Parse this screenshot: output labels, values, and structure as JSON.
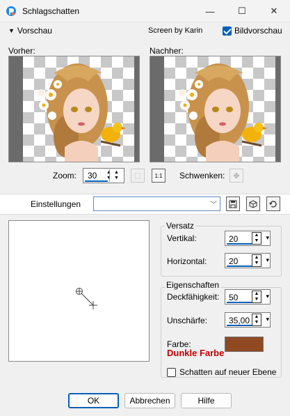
{
  "window": {
    "title": "Schlagschatten",
    "minimize_glyph": "—",
    "maximize_glyph": "☐",
    "close_glyph": "✕"
  },
  "preview": {
    "toggle_label": "Vorschau",
    "credit": "Screen by Karin",
    "live_preview_label": "Bildvorschau",
    "live_preview_checked": true,
    "before_label": "Vorher:",
    "after_label": "Nachher:"
  },
  "zoom": {
    "label": "Zoom:",
    "value": "30",
    "pan_label": "Schwenken:",
    "actual_size_icon_text": "1:1"
  },
  "settings": {
    "label": "Einstellungen",
    "value": ""
  },
  "offset": {
    "group_label": "Versatz",
    "vertical_label": "Vertikal:",
    "vertical_value": "20",
    "horizontal_label": "Horizontal:",
    "horizontal_value": "20"
  },
  "properties": {
    "group_label": "Eigenschaften",
    "opacity_label": "Deckfähigkeit:",
    "opacity_value": "50",
    "blur_label": "Unschärfe:",
    "blur_value": "35,00",
    "color_label": "Farbe:",
    "color_note": "Dunkle Farbe",
    "color_hex": "#8f4a24"
  },
  "shadow_new_layer": {
    "label": "Schatten auf neuer Ebene",
    "checked": false
  },
  "buttons": {
    "ok": "OK",
    "cancel": "Abbrechen",
    "help": "Hilfe"
  },
  "icons": {
    "app": "psp-app-icon",
    "zoom_fit": "zoom-to-fit-icon",
    "actual_size": "actual-size-icon",
    "pan": "pan-icon",
    "save_preset": "save-preset-icon",
    "load_preset": "load-preset-icon",
    "reset": "reset-icon"
  }
}
